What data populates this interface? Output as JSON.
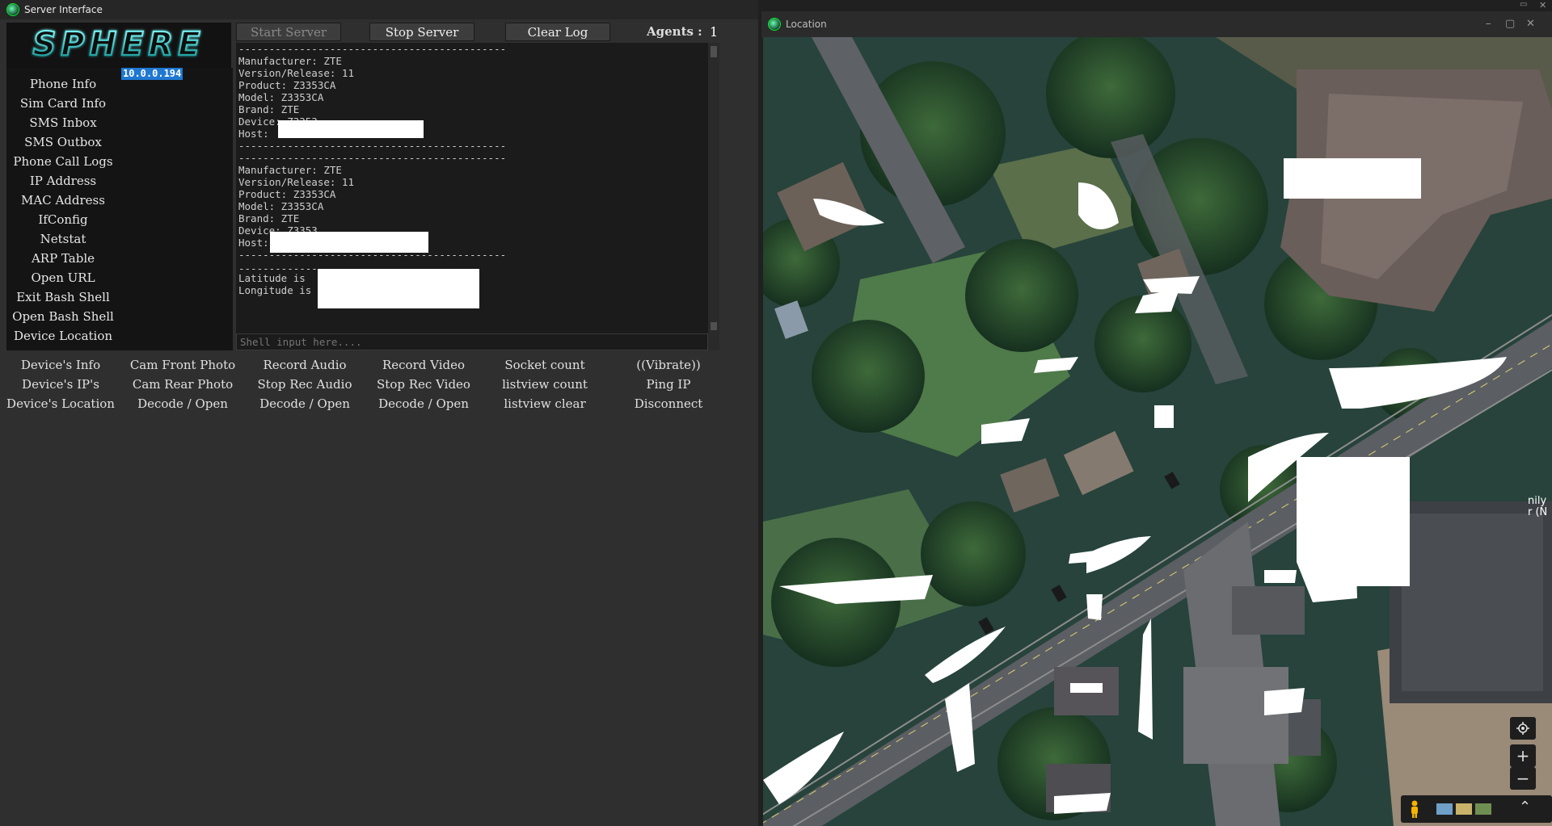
{
  "server_window": {
    "title": "Server Interface",
    "logo_text": "SPHERE",
    "buttons": {
      "start": "Start Server",
      "stop": "Stop Server",
      "clear": "Clear Log"
    },
    "agents_label": "Agents :",
    "agents_count": "1",
    "sidebar": [
      "Phone Info",
      "Sim Card Info",
      "SMS Inbox",
      "SMS Outbox",
      "Phone Call Logs",
      "IP Address",
      "MAC Address",
      "IfConfig",
      "Netstat",
      "ARP Table",
      "Open URL",
      "Exit Bash Shell",
      "Open Bash Shell",
      "Device Location"
    ],
    "agent_ip": "10.0.0.194",
    "log_lines": [
      "--------------------------------------------",
      "Manufacturer: ZTE",
      "Version/Release: 11",
      "Product: Z3353CA",
      "Model: Z3353CA",
      "Brand: ZTE",
      "Device: Z3353",
      "Host:",
      "--------------------------------------------",
      "--------------------------------------------",
      "Manufacturer: ZTE",
      "Version/Release: 11",
      "Product: Z3353CA",
      "Model: Z3353CA",
      "Brand: ZTE",
      "Device: Z3353",
      "Host:",
      "--------------------------------------------",
      "",
      "-------------------------------------",
      "Latitude is",
      "Longitude is"
    ],
    "shell_placeholder": "Shell input here....",
    "commands": [
      [
        "Device's Info",
        "Device's IP's",
        "Device's Location"
      ],
      [
        "Cam Front Photo",
        "Cam Rear Photo",
        "Decode / Open"
      ],
      [
        "Record Audio",
        "Stop Rec Audio",
        "Decode / Open"
      ],
      [
        "Record Video",
        "Stop Rec Video",
        "Decode / Open"
      ],
      [
        "Socket count",
        "listview count",
        "listview clear"
      ],
      [
        "((Vibrate))",
        "Ping IP",
        "Disconnect"
      ]
    ]
  },
  "location_window": {
    "title": "Location",
    "map_label_partial": "nily\nr (N",
    "controls": {
      "locate": "locate-icon",
      "zoom_in": "+",
      "zoom_out": "−",
      "expand": "⌃"
    }
  },
  "colors": {
    "accent_teal": "#29d4c5",
    "selection_blue": "#1f78d1",
    "panel_dark": "#141414",
    "window_bg": "#2f2f2f"
  }
}
